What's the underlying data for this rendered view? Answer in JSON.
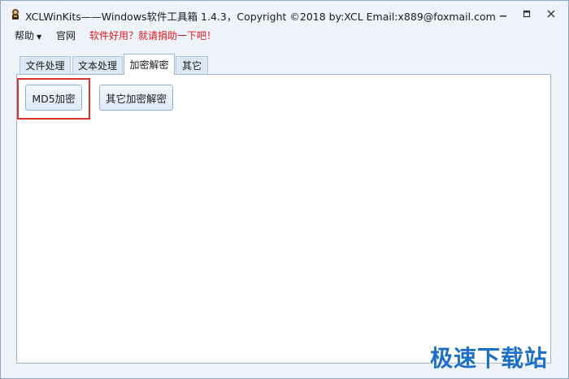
{
  "window": {
    "title": "XCLWinKits——Windows软件工具箱   1.4.3，Copyright ©2018 by:XCL Email:x889@foxmail.com"
  },
  "menu": {
    "help": "帮助",
    "official_site": "官网",
    "promo": "软件好用？就请捐助一下吧！"
  },
  "tabs": [
    {
      "label": "文件处理",
      "active": false
    },
    {
      "label": "文本处理",
      "active": false
    },
    {
      "label": "加密解密",
      "active": true
    },
    {
      "label": "其它",
      "active": false
    }
  ],
  "buttons": {
    "md5": "MD5加密",
    "other_encrypt": "其它加密解密"
  },
  "watermark": "极速下载站",
  "colors": {
    "highlight": "#e0322c",
    "promo_text": "#e0191c",
    "watermark": "#1e6fc7"
  }
}
